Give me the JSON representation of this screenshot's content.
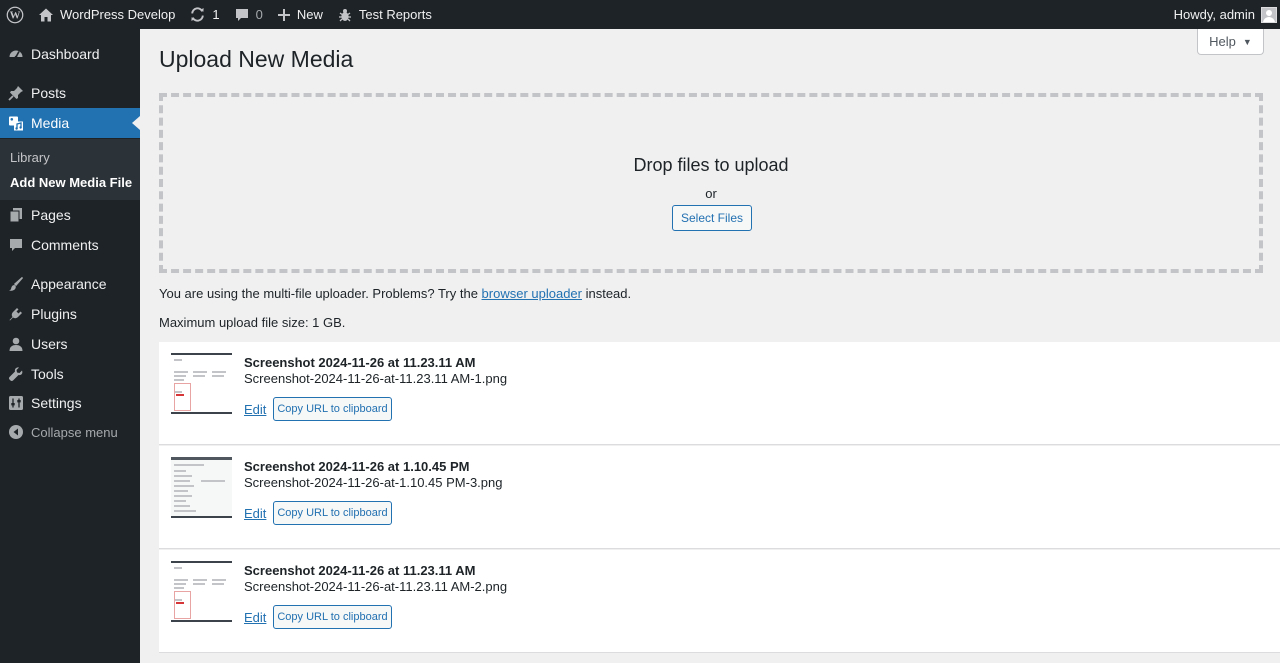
{
  "adminbar": {
    "site_name": "WordPress Develop",
    "updates_count": "1",
    "comments_count": "0",
    "new_label": "New",
    "test_reports_label": "Test Reports",
    "howdy": "Howdy, admin"
  },
  "sidebar": {
    "dashboard": "Dashboard",
    "posts": "Posts",
    "media": "Media",
    "media_sub": [
      "Library",
      "Add New Media File"
    ],
    "pages": "Pages",
    "comments": "Comments",
    "appearance": "Appearance",
    "plugins": "Plugins",
    "users": "Users",
    "tools": "Tools",
    "settings": "Settings",
    "collapse": "Collapse menu"
  },
  "main": {
    "help_label": "Help",
    "page_title": "Upload New Media",
    "drop_title": "Drop files to upload",
    "drop_or": "or",
    "select_files": "Select Files",
    "uploader_note_before": "You are using the multi-file uploader. Problems? Try the ",
    "uploader_note_link": "browser uploader",
    "uploader_note_after": " instead.",
    "max_size": "Maximum upload file size: 1 GB.",
    "edit_label": "Edit",
    "copy_label": "Copy URL to clipboard"
  },
  "media_items": [
    {
      "title": "Screenshot 2024-11-26 at 11.23.11 AM",
      "filename": "Screenshot-2024-11-26-at-11.23.11 AM-1.png"
    },
    {
      "title": "Screenshot 2024-11-26 at 1.10.45 PM",
      "filename": "Screenshot-2024-11-26-at-1.10.45 PM-3.png"
    },
    {
      "title": "Screenshot 2024-11-26 at 11.23.11 AM",
      "filename": "Screenshot-2024-11-26-at-11.23.11 AM-2.png"
    }
  ],
  "colors": {
    "admin_bar_bg": "#1d2327",
    "menu_current": "#2271b1",
    "link": "#2271b1",
    "body_bg": "#f0f0f1"
  }
}
